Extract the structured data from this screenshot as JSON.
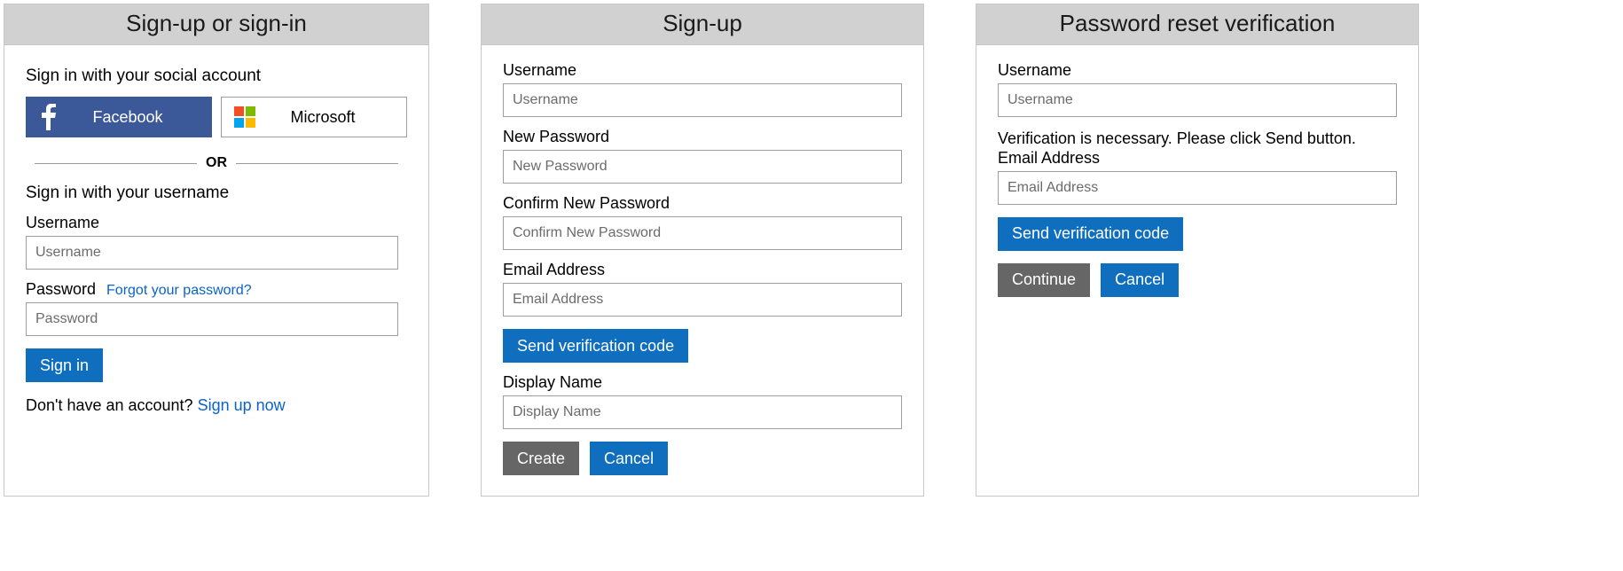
{
  "panel1": {
    "title": "Sign-up or sign-in",
    "social_heading": "Sign in with your social account",
    "facebook_label": "Facebook",
    "microsoft_label": "Microsoft",
    "divider_text": "OR",
    "username_heading": "Sign in with your username",
    "username_label": "Username",
    "username_placeholder": "Username",
    "password_label": "Password",
    "forgot_link": "Forgot your password?",
    "password_placeholder": "Password",
    "signin_button": "Sign in",
    "no_account_text": "Don't have an account? ",
    "signup_link": "Sign up now"
  },
  "panel2": {
    "title": "Sign-up",
    "username_label": "Username",
    "username_placeholder": "Username",
    "newpwd_label": "New Password",
    "newpwd_placeholder": "New Password",
    "confirm_label": "Confirm New Password",
    "confirm_placeholder": "Confirm New Password",
    "email_label": "Email Address",
    "email_placeholder": "Email Address",
    "send_code_button": "Send verification code",
    "display_label": "Display Name",
    "display_placeholder": "Display Name",
    "create_button": "Create",
    "cancel_button": "Cancel"
  },
  "panel3": {
    "title": "Password reset verification",
    "username_label": "Username",
    "username_placeholder": "Username",
    "verify_text": "Verification is necessary. Please click Send button.",
    "email_label": "Email Address",
    "email_placeholder": "Email Address",
    "send_code_button": "Send verification code",
    "continue_button": "Continue",
    "cancel_button": "Cancel"
  }
}
